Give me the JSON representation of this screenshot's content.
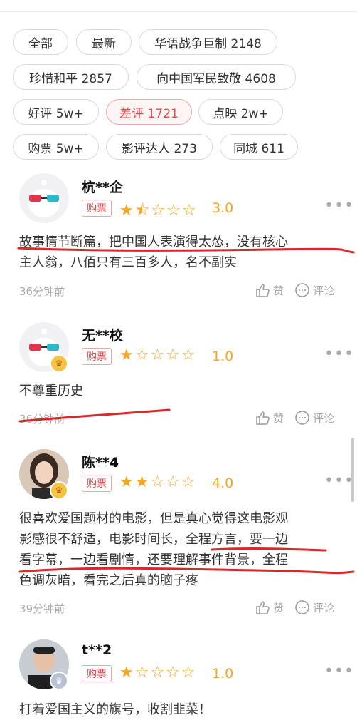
{
  "filters": [
    {
      "label": "全部"
    },
    {
      "label": "最新"
    },
    {
      "label": "华语战争巨制 2148"
    },
    {
      "label": "珍惜和平 2857"
    },
    {
      "label": "向中国军民致敬 4608"
    },
    {
      "label": "好评 5w+"
    },
    {
      "label": "差评 1721"
    },
    {
      "label": "点映 2w+"
    },
    {
      "label": "购票 5w+"
    },
    {
      "label": "影评达人 273"
    },
    {
      "label": "同城 611"
    }
  ],
  "like_label": "赞",
  "comment_label": "评论",
  "reviews": [
    {
      "user": "杭**企",
      "tag": "购票",
      "rating": 3.0,
      "score": "3.0",
      "stars": "★⯪☆☆☆",
      "lines": [
        "故事情节断篇，把中国人表演得太怂，没有核心",
        "主人翁，八佰只有三百多人，名不副实"
      ],
      "time": "36分钟前"
    },
    {
      "user": "无**校",
      "tag": "购票",
      "rating": 1.0,
      "score": "1.0",
      "stars": "★☆☆☆☆",
      "lines": [
        "不尊重历史"
      ],
      "time": "36分钟前"
    },
    {
      "user": "陈**4",
      "tag": "购票",
      "rating": 4.0,
      "score": "4.0",
      "stars": "★★☆☆☆",
      "lines": [
        "很喜欢爱国题材的电影，但是真心觉得这电影观",
        "影感很不舒适，电影时间长，全程方言，要一边",
        "看字幕，一边看剧情，还要理解事件背景，全程",
        "色调灰暗，看完之后真的脑子疼"
      ],
      "time": "39分钟前"
    },
    {
      "user": "t**2",
      "tag": "购票",
      "rating": 1.0,
      "score": "1.0",
      "stars": "★☆☆☆☆",
      "lines": [
        "打着爱国主义的旗号，收割韭菜！"
      ],
      "time": ""
    }
  ],
  "colors": {
    "accent": "#e5484d",
    "star": "#f5a623",
    "annotation": "#d42a2a"
  }
}
